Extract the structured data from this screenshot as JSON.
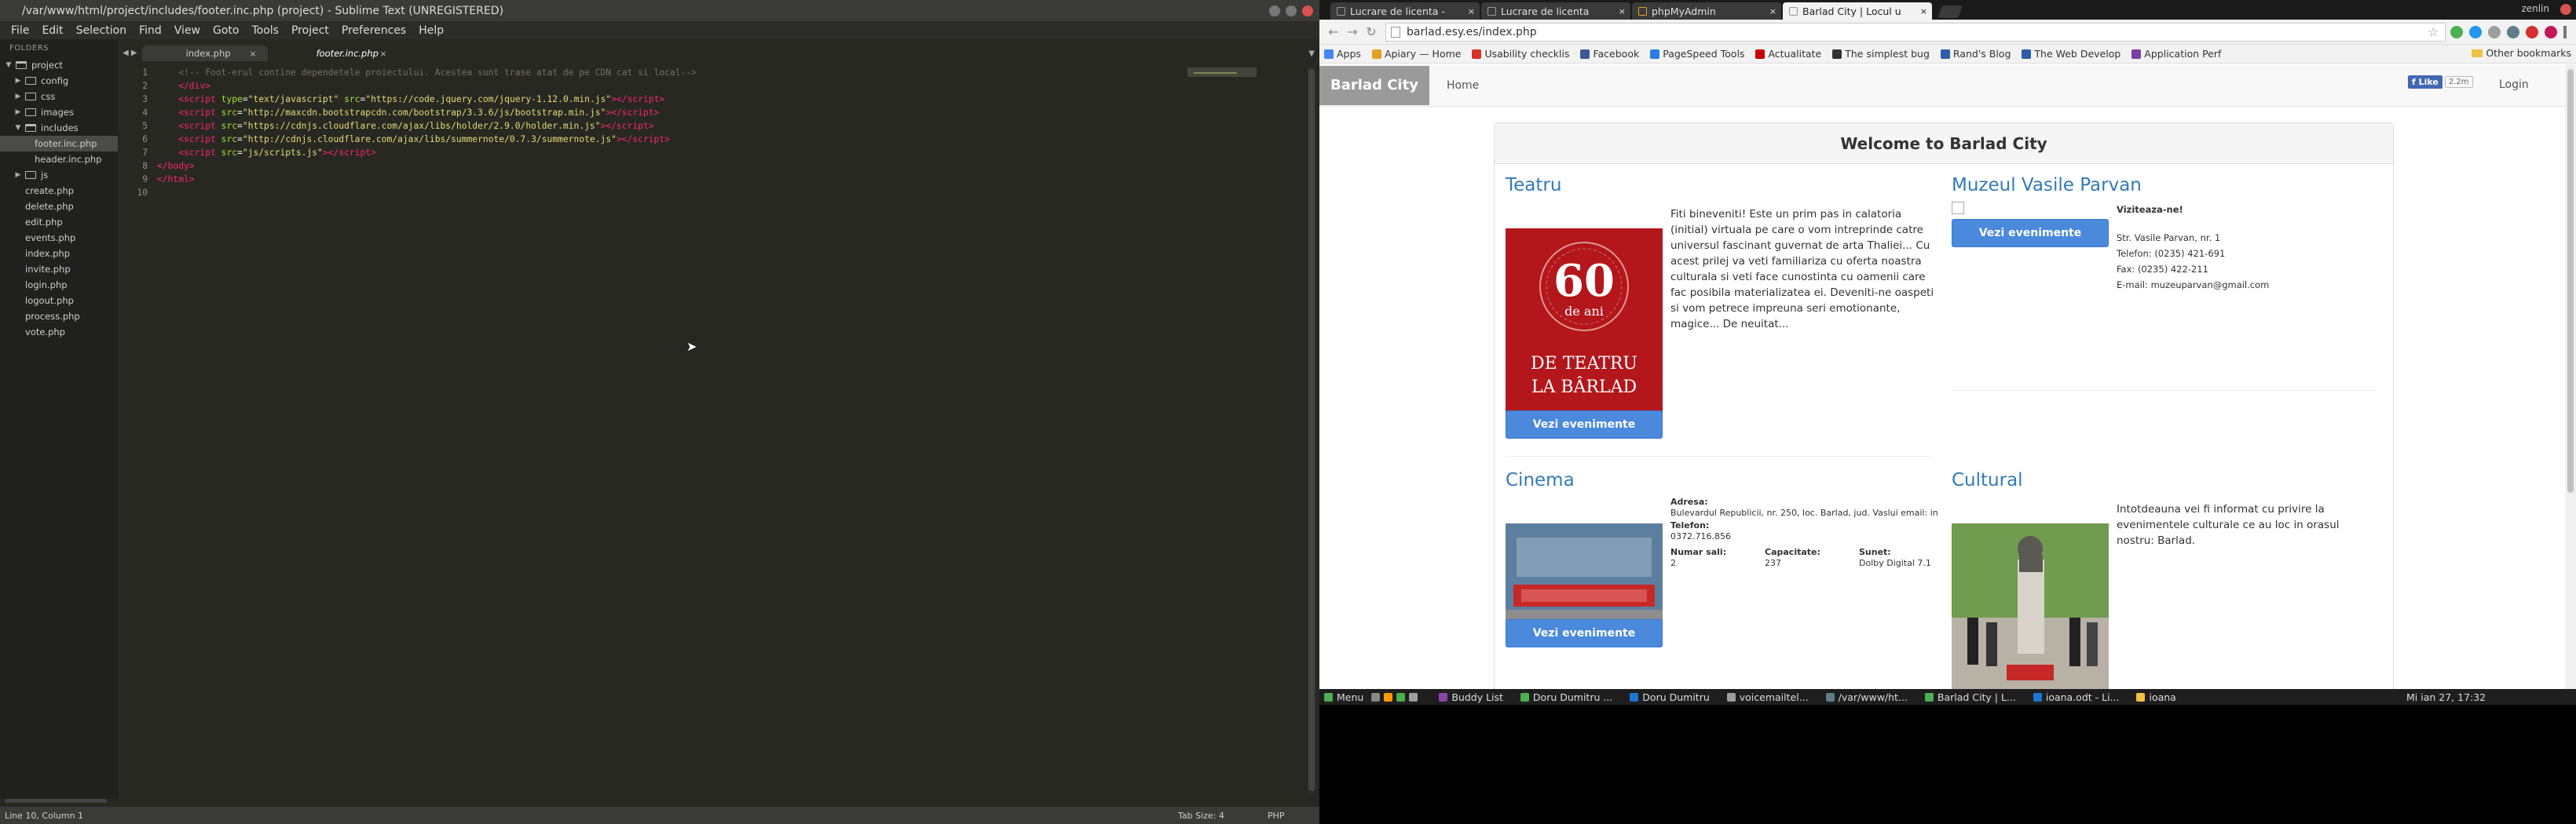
{
  "sublime": {
    "title": "/var/www/html/project/includes/footer.inc.php (project) - Sublime Text (UNREGISTERED)",
    "menu": [
      "File",
      "Edit",
      "Selection",
      "Find",
      "View",
      "Goto",
      "Tools",
      "Project",
      "Preferences",
      "Help"
    ],
    "folders_header": "FOLDERS",
    "tree": [
      {
        "label": "project",
        "type": "folder",
        "open": true,
        "depth": 0
      },
      {
        "label": "config",
        "type": "folder",
        "open": false,
        "depth": 1
      },
      {
        "label": "css",
        "type": "folder",
        "open": false,
        "depth": 1
      },
      {
        "label": "images",
        "type": "folder",
        "open": false,
        "depth": 1
      },
      {
        "label": "includes",
        "type": "folder",
        "open": true,
        "depth": 1
      },
      {
        "label": "footer.inc.php",
        "type": "file",
        "depth": 2,
        "selected": true
      },
      {
        "label": "header.inc.php",
        "type": "file",
        "depth": 2
      },
      {
        "label": "js",
        "type": "folder",
        "open": false,
        "depth": 1
      },
      {
        "label": "create.php",
        "type": "file",
        "depth": 1
      },
      {
        "label": "delete.php",
        "type": "file",
        "depth": 1
      },
      {
        "label": "edit.php",
        "type": "file",
        "depth": 1
      },
      {
        "label": "events.php",
        "type": "file",
        "depth": 1
      },
      {
        "label": "index.php",
        "type": "file",
        "depth": 1
      },
      {
        "label": "invite.php",
        "type": "file",
        "depth": 1
      },
      {
        "label": "login.php",
        "type": "file",
        "depth": 1
      },
      {
        "label": "logout.php",
        "type": "file",
        "depth": 1
      },
      {
        "label": "process.php",
        "type": "file",
        "depth": 1
      },
      {
        "label": "vote.php",
        "type": "file",
        "depth": 1
      }
    ],
    "tabs": [
      {
        "label": "index.php",
        "active": false
      },
      {
        "label": "footer.inc.php",
        "active": true
      }
    ],
    "line_numbers": [
      "1",
      "2",
      "3",
      "4",
      "5",
      "6",
      "7",
      "8",
      "9",
      "10"
    ],
    "status_left": "Line 10, Column 1",
    "status_tab": "Tab Size: 4",
    "status_syntax": "PHP"
  },
  "chrome": {
    "tabs": [
      {
        "label": "Lucrare de licenta - ",
        "active": false
      },
      {
        "label": "Lucrare de licenta",
        "active": false
      },
      {
        "label": "phpMyAdmin",
        "active": false
      },
      {
        "label": "Barlad City | Locul u",
        "active": true
      }
    ],
    "user": "zenlin",
    "url": "barlad.esy.es/index.php",
    "bookmarks": [
      "Apps",
      "Apiary — Home",
      "Usability checklis",
      "Facebook",
      "PageSpeed Tools",
      "Actualitate",
      "The simplest bug",
      "Rand's Blog",
      "The Web Develop",
      "Application Perf"
    ],
    "bookmark_colors": [
      "#4285f4",
      "#e5a021",
      "#d93025",
      "#3b5998",
      "#2a7de1",
      "#cc0000",
      "#333333",
      "#2a5ea8",
      "#2a5ea8",
      "#7a3fa0"
    ],
    "other_bookmarks": "Other bookmarks"
  },
  "site": {
    "brand": "Barlad City",
    "nav_home": "Home",
    "fb_like": "Like",
    "fb_count": "2.2m",
    "login": "Login",
    "welcome": "Welcome to Barlad City",
    "button_label": "Vezi evenimente",
    "teatru": {
      "title": "Teatru",
      "poster_line1": "60",
      "poster_line2": "de ani",
      "poster_line3": "DE TEATRU",
      "poster_line4": "LA BÂRLAD",
      "desc": "Fiti bineveniti! Este un prim pas in calatoria (initial) virtuala pe care o vom intreprinde catre universul fascinant guvernat de arta Thaliei... Cu acest prilej va veti familiariza cu oferta noastra culturala si veti face cunostinta cu oamenii care fac posibila materializatea ei. Deveniti-ne oaspeti si vom petrece impreuna seri emotionante, magice... De neuitat..."
    },
    "muzeu": {
      "title": "Muzeul Vasile Parvan",
      "subtitle": "Viziteaza-ne!",
      "address": "Str. Vasile Parvan, nr. 1",
      "phone": "Telefon: (0235) 421-691",
      "fax": "Fax: (0235) 422-211",
      "email": "E-mail: muzeuparvan@gmail.com"
    },
    "cinema": {
      "title": "Cinema",
      "adresa_label": "Adresa:",
      "adresa": "Bulevardul Republicii, nr. 250, loc. Barlad, jud. Vaslui email: info.cit@",
      "telefon_label": "Telefon:",
      "telefon": "0372.716.856",
      "sali_label": "Numar sali:",
      "sali": "2",
      "cap_label": "Capacitate:",
      "cap": "237",
      "sunet_label": "Sunet:",
      "sunet": "Dolby Digital 7.1"
    },
    "cultural": {
      "title": "Cultural",
      "desc": "Intotdeauna vei fi informat cu privire la evenimentele culturale ce au loc in orasul nostru: Barlad."
    }
  },
  "taskbar": {
    "menu": "Menu",
    "items": [
      "Buddy List",
      "Doru Dumitru ...",
      "Doru Dumitru",
      "voicemailtel...",
      "/var/www/ht...",
      "Barlad City | L...",
      "ioana.odt - Li...",
      "ioana"
    ],
    "clock": "Mi ian 27, 17:32"
  }
}
